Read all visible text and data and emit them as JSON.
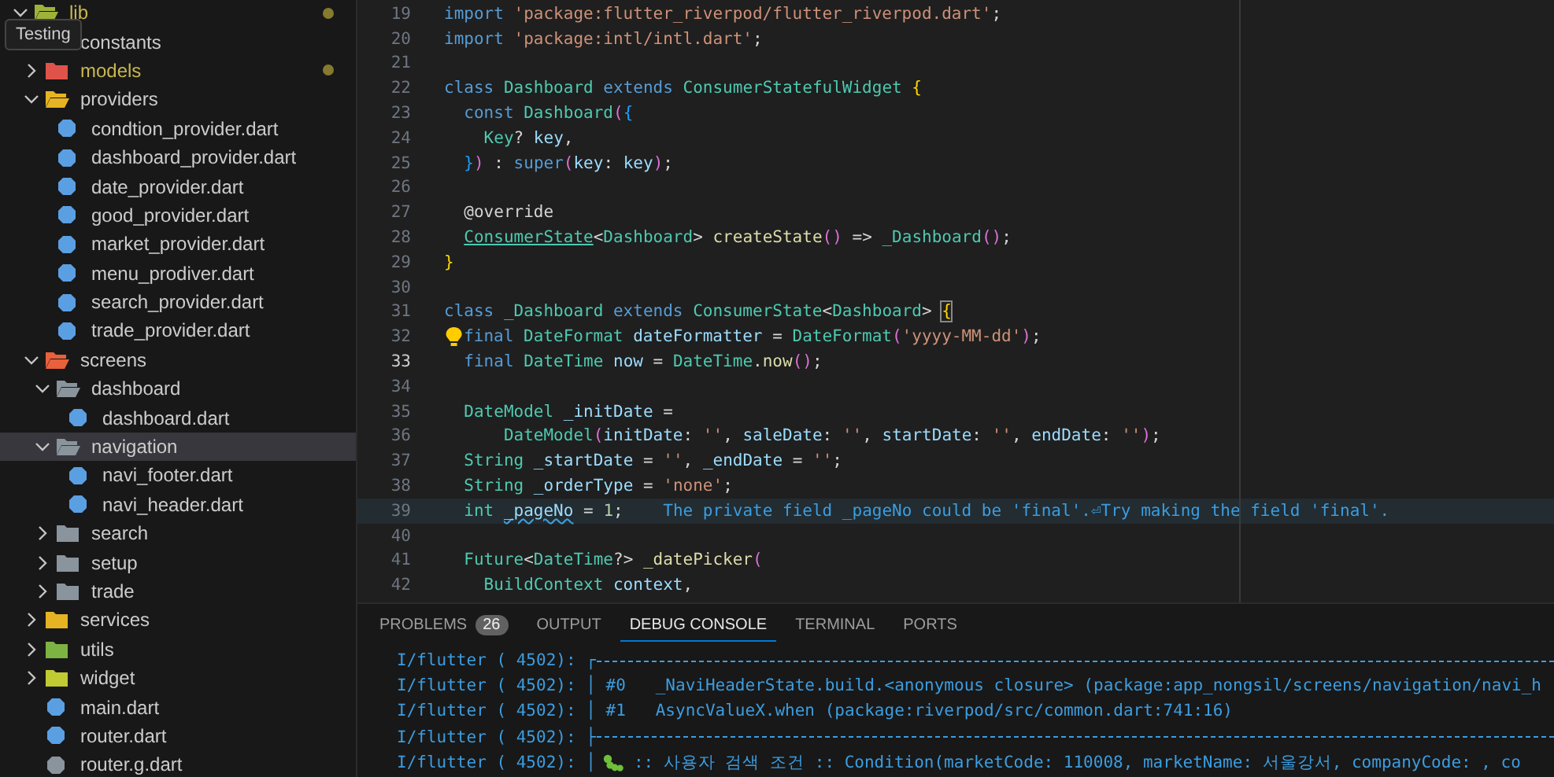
{
  "explorer": {
    "tooltip": "Testing",
    "tree": [
      {
        "name": "lib",
        "kind": "folder",
        "expanded": true,
        "selected": false,
        "modified": true,
        "color": "#9fb23a",
        "children": [
          {
            "name": "constants",
            "selected": false,
            "modified": false
          },
          {
            "name": "models",
            "kind": "folder",
            "expanded": false,
            "selected": false,
            "modified": true,
            "color": "#e0534a"
          },
          {
            "name": "providers",
            "kind": "folder",
            "expanded": true,
            "selected": false,
            "modified": false,
            "color": "#e6b422",
            "children": [
              {
                "name": "condtion_provider.dart",
                "kind": "file",
                "selected": false,
                "modified": false,
                "color": "#5b9fe3"
              },
              {
                "name": "dashboard_provider.dart",
                "kind": "file",
                "selected": false,
                "modified": false,
                "color": "#5b9fe3"
              },
              {
                "name": "date_provider.dart",
                "kind": "file",
                "selected": false,
                "modified": false,
                "color": "#5b9fe3"
              },
              {
                "name": "good_provider.dart",
                "kind": "file",
                "selected": false,
                "modified": false,
                "color": "#5b9fe3"
              },
              {
                "name": "market_provider.dart",
                "kind": "file",
                "selected": false,
                "modified": false,
                "color": "#5b9fe3"
              },
              {
                "name": "menu_prodiver.dart",
                "kind": "file",
                "selected": false,
                "modified": false,
                "color": "#5b9fe3"
              },
              {
                "name": "search_provider.dart",
                "kind": "file",
                "selected": false,
                "modified": false,
                "color": "#5b9fe3"
              },
              {
                "name": "trade_provider.dart",
                "kind": "file",
                "selected": false,
                "modified": false,
                "color": "#5b9fe3"
              }
            ]
          },
          {
            "name": "screens",
            "kind": "folder",
            "expanded": true,
            "selected": false,
            "modified": false,
            "color": "#e8603c",
            "children": [
              {
                "name": "dashboard",
                "kind": "folder",
                "expanded": true,
                "selected": false,
                "modified": false,
                "color": "#8a949c",
                "children": [
                  {
                    "name": "dashboard.dart",
                    "kind": "file",
                    "selected": false,
                    "modified": false,
                    "color": "#5b9fe3"
                  }
                ]
              },
              {
                "name": "navigation",
                "kind": "folder",
                "expanded": true,
                "selected": true,
                "modified": false,
                "color": "#8a949c",
                "children": [
                  {
                    "name": "navi_footer.dart",
                    "kind": "file",
                    "selected": false,
                    "modified": false,
                    "color": "#5b9fe3"
                  },
                  {
                    "name": "navi_header.dart",
                    "kind": "file",
                    "selected": false,
                    "modified": false,
                    "color": "#5b9fe3"
                  }
                ]
              },
              {
                "name": "search",
                "kind": "folder",
                "expanded": false,
                "selected": false,
                "modified": false,
                "color": "#8a949c"
              },
              {
                "name": "setup",
                "kind": "folder",
                "expanded": false,
                "selected": false,
                "modified": false,
                "color": "#8a949c"
              },
              {
                "name": "trade",
                "kind": "folder",
                "expanded": false,
                "selected": false,
                "modified": false,
                "color": "#8a949c"
              }
            ]
          },
          {
            "name": "services",
            "kind": "folder",
            "expanded": false,
            "selected": false,
            "modified": false,
            "color": "#e6b422"
          },
          {
            "name": "utils",
            "kind": "folder",
            "expanded": false,
            "selected": false,
            "modified": false,
            "color": "#7cb342"
          },
          {
            "name": "widget",
            "kind": "folder",
            "expanded": false,
            "selected": false,
            "modified": false,
            "color": "#c0ca33"
          },
          {
            "name": "main.dart",
            "kind": "file",
            "selected": false,
            "modified": false,
            "color": "#5b9fe3"
          },
          {
            "name": "router.dart",
            "kind": "file",
            "selected": false,
            "modified": false,
            "color": "#5b9fe3"
          },
          {
            "name": "router.g.dart",
            "kind": "file",
            "selected": false,
            "modified": false,
            "color": "#8a949c"
          }
        ]
      }
    ]
  },
  "editor": {
    "lines": [
      {
        "n": "19",
        "current": false,
        "highlighted": false,
        "tokens": [
          {
            "text": "import",
            "kind": "kw"
          },
          {
            "text": " 'package:flutter_riverpod/flutter_riverpod.dart'",
            "kind": "str"
          },
          {
            "text": ";",
            "kind": "p"
          }
        ]
      },
      {
        "n": "20",
        "current": false,
        "highlighted": false,
        "tokens": [
          {
            "text": "import",
            "kind": "kw"
          },
          {
            "text": " 'package:intl/intl.dart'",
            "kind": "str"
          },
          {
            "text": ";",
            "kind": "p"
          }
        ]
      },
      {
        "n": "21",
        "current": false,
        "highlighted": false
      },
      {
        "n": "22",
        "current": false,
        "highlighted": false,
        "tokens": [
          {
            "text": "class",
            "kind": "kw"
          },
          {
            "text": " Dashboard",
            "kind": "type"
          },
          {
            "text": " extends",
            "kind": "kw"
          },
          {
            "text": " ConsumerStatefulWidget",
            "kind": "type"
          },
          {
            "text": " {",
            "kind": "b1"
          }
        ]
      },
      {
        "n": "23",
        "current": false,
        "highlighted": false,
        "tokens": [
          {
            "text": "  const",
            "kind": "kw"
          },
          {
            "text": " Dashboard",
            "kind": "type"
          },
          {
            "text": "(",
            "kind": "b2"
          },
          {
            "text": "{",
            "kind": "b3"
          }
        ]
      },
      {
        "n": "24",
        "current": false,
        "highlighted": false,
        "tokens": [
          {
            "text": "    Key",
            "kind": "type"
          },
          {
            "text": "? ",
            "kind": "p"
          },
          {
            "text": "key",
            "kind": "var"
          },
          {
            "text": ",",
            "kind": "p"
          }
        ]
      },
      {
        "n": "25",
        "current": false,
        "highlighted": false,
        "tokens": [
          {
            "text": "  }",
            "kind": "b3"
          },
          {
            "text": ")",
            "kind": "b2"
          },
          {
            "text": " : ",
            "kind": "p"
          },
          {
            "text": "super",
            "kind": "kw"
          },
          {
            "text": "(",
            "kind": "b2"
          },
          {
            "text": "key",
            "kind": "var"
          },
          {
            "text": ": ",
            "kind": "p"
          },
          {
            "text": "key",
            "kind": "var"
          },
          {
            "text": ")",
            "kind": "b2"
          },
          {
            "text": ";",
            "kind": "p"
          }
        ]
      },
      {
        "n": "26",
        "current": false,
        "highlighted": false
      },
      {
        "n": "27",
        "current": false,
        "highlighted": false,
        "tokens": [
          {
            "text": "  @override",
            "kind": "p"
          }
        ]
      },
      {
        "n": "28",
        "current": false,
        "highlighted": false,
        "tokens": [
          {
            "text": "  ConsumerState",
            "kind": "link"
          },
          {
            "text": "<",
            "kind": "p"
          },
          {
            "text": "Dashboard",
            "kind": "type"
          },
          {
            "text": "> ",
            "kind": "p"
          },
          {
            "text": "createState",
            "kind": "fn"
          },
          {
            "text": "()",
            "kind": "b2"
          },
          {
            "text": " => ",
            "kind": "p"
          },
          {
            "text": "_Dashboard",
            "kind": "type"
          },
          {
            "text": "()",
            "kind": "b2"
          },
          {
            "text": ";",
            "kind": "p"
          }
        ]
      },
      {
        "n": "29",
        "current": false,
        "highlighted": false,
        "tokens": [
          {
            "text": "}",
            "kind": "b1"
          }
        ]
      },
      {
        "n": "30",
        "current": false,
        "highlighted": false
      },
      {
        "n": "31",
        "current": false,
        "highlighted": false,
        "tokens": [
          {
            "text": "class",
            "kind": "kw"
          },
          {
            "text": " _Dashboard",
            "kind": "type"
          },
          {
            "text": " extends",
            "kind": "kw"
          },
          {
            "text": " ConsumerState",
            "kind": "type"
          },
          {
            "text": "<",
            "kind": "p"
          },
          {
            "text": "Dashboard",
            "kind": "type"
          },
          {
            "text": "> ",
            "kind": "p"
          },
          {
            "text": "{",
            "kind": "bm"
          }
        ]
      },
      {
        "n": "32",
        "current": false,
        "highlighted": false,
        "tokens": [
          {
            "kind": "bulb"
          },
          {
            "text": "final",
            "kind": "kw"
          },
          {
            "text": " DateFormat",
            "kind": "type"
          },
          {
            "text": " dateFormatter",
            "kind": "var"
          },
          {
            "text": " = ",
            "kind": "p"
          },
          {
            "text": "DateFormat",
            "kind": "type"
          },
          {
            "text": "(",
            "kind": "b2"
          },
          {
            "text": "'yyyy-MM-dd'",
            "kind": "str"
          },
          {
            "text": ")",
            "kind": "b2"
          },
          {
            "text": ";",
            "kind": "p"
          }
        ]
      },
      {
        "n": "33",
        "current": true,
        "highlighted": false,
        "tokens": [
          {
            "text": "  final",
            "kind": "kw"
          },
          {
            "text": " DateTime",
            "kind": "type"
          },
          {
            "text": " now",
            "kind": "var"
          },
          {
            "text": " = ",
            "kind": "p"
          },
          {
            "text": "DateTime",
            "kind": "type"
          },
          {
            "text": ".",
            "kind": "p"
          },
          {
            "text": "now",
            "kind": "fn"
          },
          {
            "text": "()",
            "kind": "b2"
          },
          {
            "text": ";",
            "kind": "p"
          }
        ]
      },
      {
        "n": "34",
        "current": false,
        "highlighted": false
      },
      {
        "n": "35",
        "current": false,
        "highlighted": false,
        "tokens": [
          {
            "text": "  DateModel",
            "kind": "type"
          },
          {
            "text": " _initDate",
            "kind": "var"
          },
          {
            "text": " =",
            "kind": "p"
          }
        ]
      },
      {
        "n": "36",
        "current": false,
        "highlighted": false,
        "tokens": [
          {
            "text": "      DateModel",
            "kind": "type"
          },
          {
            "text": "(",
            "kind": "b2"
          },
          {
            "text": "initDate",
            "kind": "var"
          },
          {
            "text": ": ",
            "kind": "p"
          },
          {
            "text": "''",
            "kind": "str"
          },
          {
            "text": ", ",
            "kind": "p"
          },
          {
            "text": "saleDate",
            "kind": "var"
          },
          {
            "text": ": ",
            "kind": "p"
          },
          {
            "text": "''",
            "kind": "str"
          },
          {
            "text": ", ",
            "kind": "p"
          },
          {
            "text": "startDate",
            "kind": "var"
          },
          {
            "text": ": ",
            "kind": "p"
          },
          {
            "text": "''",
            "kind": "str"
          },
          {
            "text": ", ",
            "kind": "p"
          },
          {
            "text": "endDate",
            "kind": "var"
          },
          {
            "text": ": ",
            "kind": "p"
          },
          {
            "text": "''",
            "kind": "str"
          },
          {
            "text": ")",
            "kind": "b2"
          },
          {
            "text": ";",
            "kind": "p"
          }
        ]
      },
      {
        "n": "37",
        "current": false,
        "highlighted": false,
        "tokens": [
          {
            "text": "  String",
            "kind": "type"
          },
          {
            "text": " _startDate",
            "kind": "var"
          },
          {
            "text": " = ",
            "kind": "p"
          },
          {
            "text": "''",
            "kind": "str"
          },
          {
            "text": ", ",
            "kind": "p"
          },
          {
            "text": "_endDate",
            "kind": "var"
          },
          {
            "text": " = ",
            "kind": "p"
          },
          {
            "text": "''",
            "kind": "str"
          },
          {
            "text": ";",
            "kind": "p"
          }
        ]
      },
      {
        "n": "38",
        "current": false,
        "highlighted": false,
        "tokens": [
          {
            "text": "  String",
            "kind": "type"
          },
          {
            "text": " _orderType",
            "kind": "var"
          },
          {
            "text": " = ",
            "kind": "p"
          },
          {
            "text": "'none'",
            "kind": "str"
          },
          {
            "text": ";",
            "kind": "p"
          }
        ]
      },
      {
        "n": "39",
        "current": false,
        "highlighted": true,
        "tokens": [
          {
            "text": "  int",
            "kind": "type"
          },
          {
            "text": " _pageNo",
            "kind": "warn"
          },
          {
            "text": " = ",
            "kind": "p"
          },
          {
            "text": "1",
            "kind": "num"
          },
          {
            "text": ";",
            "kind": "p"
          },
          {
            "text": "The private field _pageNo could be 'final'.⏎Try making the field 'final'.",
            "kind": "hint"
          }
        ]
      },
      {
        "n": "40",
        "current": false,
        "highlighted": false
      },
      {
        "n": "41",
        "current": false,
        "highlighted": false,
        "tokens": [
          {
            "text": "  Future",
            "kind": "type"
          },
          {
            "text": "<",
            "kind": "p"
          },
          {
            "text": "DateTime",
            "kind": "type"
          },
          {
            "text": "?> ",
            "kind": "p"
          },
          {
            "text": "_datePicker",
            "kind": "fn"
          },
          {
            "text": "(",
            "kind": "b2"
          }
        ]
      },
      {
        "n": "42",
        "current": false,
        "highlighted": false,
        "tokens": [
          {
            "text": "    BuildContext",
            "kind": "type"
          },
          {
            "text": " context",
            "kind": "var"
          },
          {
            "text": ",",
            "kind": "p"
          }
        ]
      }
    ]
  },
  "panel": {
    "tabs": [
      {
        "label": "PROBLEMS",
        "badge": "26",
        "selected": false
      },
      {
        "label": "OUTPUT",
        "selected": false
      },
      {
        "label": "DEBUG CONSOLE",
        "selected": true
      },
      {
        "label": "TERMINAL",
        "selected": false
      },
      {
        "label": "PORTS",
        "selected": false
      }
    ],
    "console": [
      {
        "kind": "rule",
        "text": "I/flutter ( 4502): ┌"
      },
      {
        "kind": "text",
        "text": "I/flutter ( 4502): │ #0   _NaviHeaderState.build.<anonymous closure> (package:app_nongsil/screens/navigation/navi_h"
      },
      {
        "kind": "text",
        "text": "I/flutter ( 4502): │ #1   AsyncValueX.when (package:riverpod/src/common.dart:741:16)"
      },
      {
        "kind": "rule",
        "text": "I/flutter ( 4502): ├"
      },
      {
        "kind": "log",
        "text": "I/flutter ( 4502): │",
        "after_icon": ":: 사용자 검색 조건 :: Condition(marketCode: 110008, marketName: 서울강서, companyCode: , co"
      }
    ]
  }
}
